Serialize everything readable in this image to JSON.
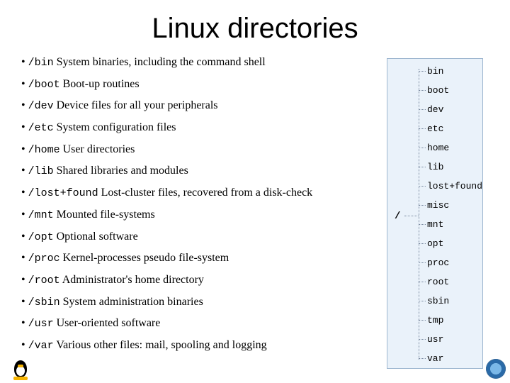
{
  "title": "Linux directories",
  "bullets": [
    {
      "dir": "/bin",
      "desc": "System binaries, including the command shell"
    },
    {
      "dir": "/boot",
      "desc": "Boot-up routines"
    },
    {
      "dir": "/dev",
      "desc": "Device files for all your peripherals"
    },
    {
      "dir": "/etc",
      "desc": "System configuration files"
    },
    {
      "dir": "/home",
      "desc": "User directories"
    },
    {
      "dir": "/lib",
      "desc": "Shared libraries and modules"
    },
    {
      "dir": "/lost+found",
      "desc": "Lost-cluster files, recovered from a disk-check"
    },
    {
      "dir": "/mnt",
      "desc": "Mounted file-systems"
    },
    {
      "dir": "/opt",
      "desc": "Optional software"
    },
    {
      "dir": "/proc",
      "desc": "Kernel-processes pseudo file-system"
    },
    {
      "dir": "/root",
      "desc": "Administrator's home directory"
    },
    {
      "dir": "/sbin",
      "desc": "System administration binaries"
    },
    {
      "dir": "/usr",
      "desc": "User-oriented software"
    },
    {
      "dir": "/var",
      "desc": "Various other files: mail, spooling and logging"
    }
  ],
  "tree": {
    "root": "/",
    "items": [
      "bin",
      "boot",
      "dev",
      "etc",
      "home",
      "lib",
      "lost+found",
      "misc",
      "mnt",
      "opt",
      "proc",
      "root",
      "sbin",
      "tmp",
      "usr",
      "var"
    ]
  }
}
